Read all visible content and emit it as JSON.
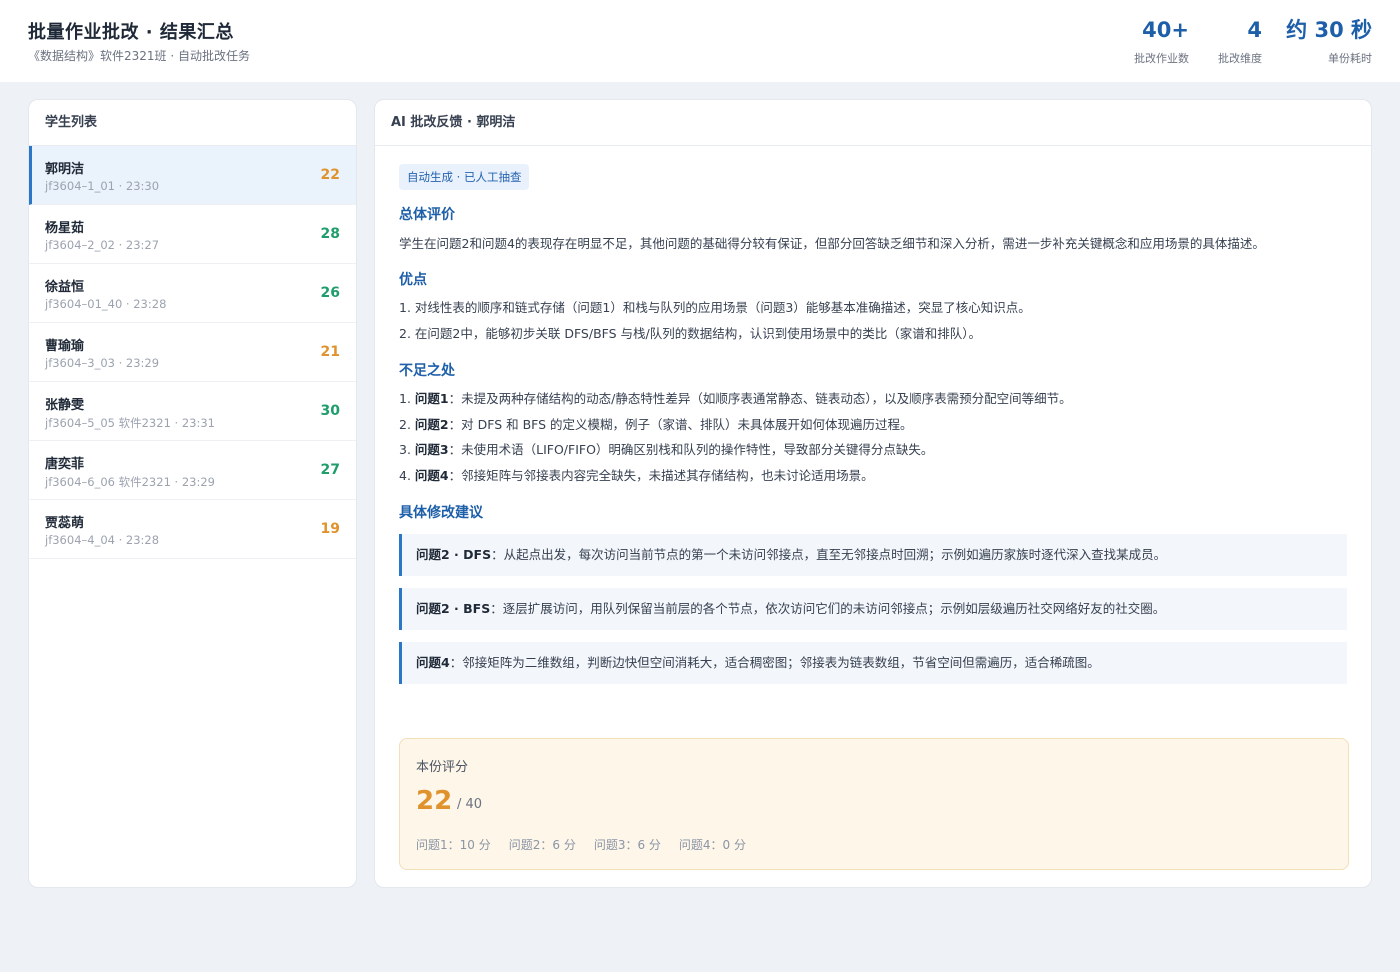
{
  "header": {
    "title": "批量作业批改 · 结果汇总",
    "subtitle": "《数据结构》软件2321班 · 自动批改任务",
    "stats": [
      {
        "value": "40+",
        "label": "批改作业数"
      },
      {
        "value": "4",
        "label": "批改维度"
      },
      {
        "value": "约 30 秒",
        "label": "单份耗时"
      }
    ]
  },
  "student_list": {
    "title": "学生列表",
    "items": [
      {
        "name": "郭明洁",
        "meta": "jf3604–1_01 · 23:30",
        "score": "22",
        "color": "#e0932c",
        "active": true
      },
      {
        "name": "杨星茹",
        "meta": "jf3604–2_02 · 23:27",
        "score": "28",
        "color": "#1f9d6b"
      },
      {
        "name": "徐益恒",
        "meta": "jf3604–01_40 · 23:28",
        "score": "26",
        "color": "#1f9d6b"
      },
      {
        "name": "曹瑜瑜",
        "meta": "jf3604–3_03 · 23:29",
        "score": "21",
        "color": "#e0932c"
      },
      {
        "name": "张静雯",
        "meta": "jf3604–5_05 软件2321 · 23:31",
        "score": "30",
        "color": "#1f9d6b"
      },
      {
        "name": "唐奕菲",
        "meta": "jf3604–6_06 软件2321 · 23:29",
        "score": "27",
        "color": "#1f9d6b"
      },
      {
        "name": "贾蕊萌",
        "meta": "jf3604–4_04 · 23:28",
        "score": "19",
        "color": "#e0932c"
      }
    ]
  },
  "feedback": {
    "title": "AI 批改反馈 · 郭明洁",
    "tag": "自动生成 · 已人工抽查",
    "overall_title": "总体评价",
    "overall_text": "学生在问题2和问题4的表现存在明显不足，其他问题的基础得分较有保证，但部分回答缺乏细节和深入分析，需进一步补充关键概念和应用场景的具体描述。",
    "strengths_title": "优点",
    "strengths": [
      "1. 对线性表的顺序和链式存储（问题1）和栈与队列的应用场景（问题3）能够基本准确描述，突显了核心知识点。",
      "2. 在问题2中，能够初步关联 DFS/BFS 与栈/队列的数据结构，认识到使用场景中的类比（家谱和排队）。"
    ],
    "weaknesses_title": "不足之处",
    "weaknesses": [
      {
        "num": "1.",
        "label": "问题1",
        "text": "：未提及两种存储结构的动态/静态特性差异（如顺序表通常静态、链表动态），以及顺序表需预分配空间等细节。"
      },
      {
        "num": "2.",
        "label": "问题2",
        "text": "：对 DFS 和 BFS 的定义模糊，例子（家谱、排队）未具体展开如何体现遍历过程。"
      },
      {
        "num": "3.",
        "label": "问题3",
        "text": "：未使用术语（LIFO/FIFO）明确区别栈和队列的操作特性，导致部分关键得分点缺失。"
      },
      {
        "num": "4.",
        "label": "问题4",
        "text": "：邻接矩阵与邻接表内容完全缺失，未描述其存储结构，也未讨论适用场景。"
      }
    ],
    "suggestions_title": "具体修改建议",
    "suggestions": [
      {
        "label": "问题2 · DFS",
        "text": "：从起点出发，每次访问当前节点的第一个未访问邻接点，直至无邻接点时回溯；示例如遍历家族时逐代深入查找某成员。"
      },
      {
        "label": "问题2 · BFS",
        "text": "：逐层扩展访问，用队列保留当前层的各个节点，依次访问它们的未访问邻接点；示例如层级遍历社交网络好友的社交圈。"
      },
      {
        "label": "问题4",
        "text": "：邻接矩阵为二维数组，判断边快但空间消耗大，适合稠密图；邻接表为链表数组，节省空间但需遍历，适合稀疏图。"
      }
    ],
    "score": {
      "label": "本份评分",
      "value": "22",
      "total": "/ 40",
      "breakdown": [
        "问题1：10 分",
        "问题2：6 分",
        "问题3：6 分",
        "问题4：0 分"
      ]
    }
  }
}
